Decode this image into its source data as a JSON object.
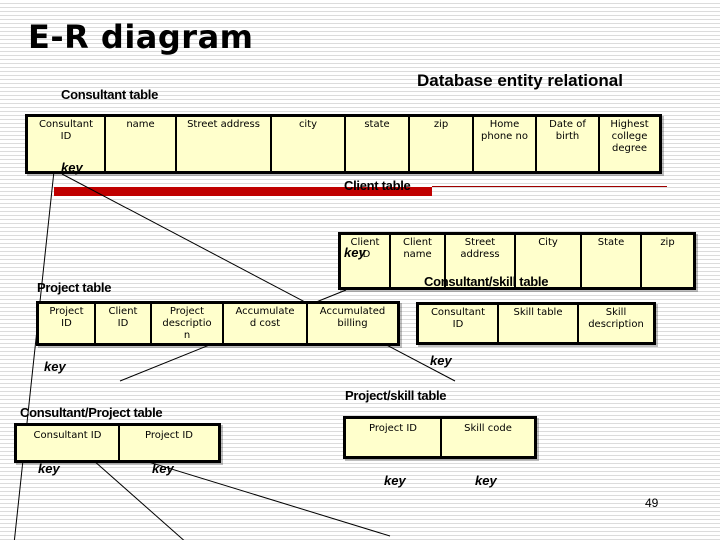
{
  "title": "E-R diagram",
  "subtitle": "Database entity relational",
  "page_number": "49",
  "key_label": "key",
  "colors": {
    "cell_fill": "#ffffcc",
    "accent_bar": "#c00000"
  },
  "tables": {
    "consultant": {
      "name": "Consultant table",
      "columns": [
        "Consultant\nID",
        "name",
        "Street address",
        "city",
        "state",
        "zip",
        "Home\nphone no",
        "Date of\nbirth",
        "Highest\ncollege\ndegree"
      ]
    },
    "client": {
      "name": "Client table",
      "columns": [
        "Client\nID",
        "Client\nname",
        "Street\naddress",
        "City",
        "State",
        "zip"
      ]
    },
    "project": {
      "name": "Project table",
      "columns": [
        "Project\nID",
        "Client\nID",
        "Project\ndescriptio\nn",
        "Accumulate\nd cost",
        "Accumulated\nbilling"
      ]
    },
    "consultant_skill": {
      "name": "Consultant/skill table",
      "columns": [
        "Consultant\nID",
        "Skill table",
        "Skill\ndescription"
      ]
    },
    "consultant_project": {
      "name": "Consultant/Project table",
      "columns": [
        "Consultant ID",
        "Project ID"
      ]
    },
    "project_skill": {
      "name": "Project/skill table",
      "columns": [
        "Project ID",
        "Skill code"
      ]
    }
  },
  "relationships": [
    {
      "from": "consultant.Consultant ID",
      "to": "consultant_project.Consultant ID"
    },
    {
      "from": "consultant.Consultant ID",
      "to": "consultant_skill.Consultant ID"
    },
    {
      "from": "client.Client ID",
      "to": "project.Client ID"
    },
    {
      "from": "project.Project ID",
      "to": "consultant_project.Project ID"
    },
    {
      "from": "project.Project ID",
      "to": "project_skill.Project ID"
    }
  ]
}
